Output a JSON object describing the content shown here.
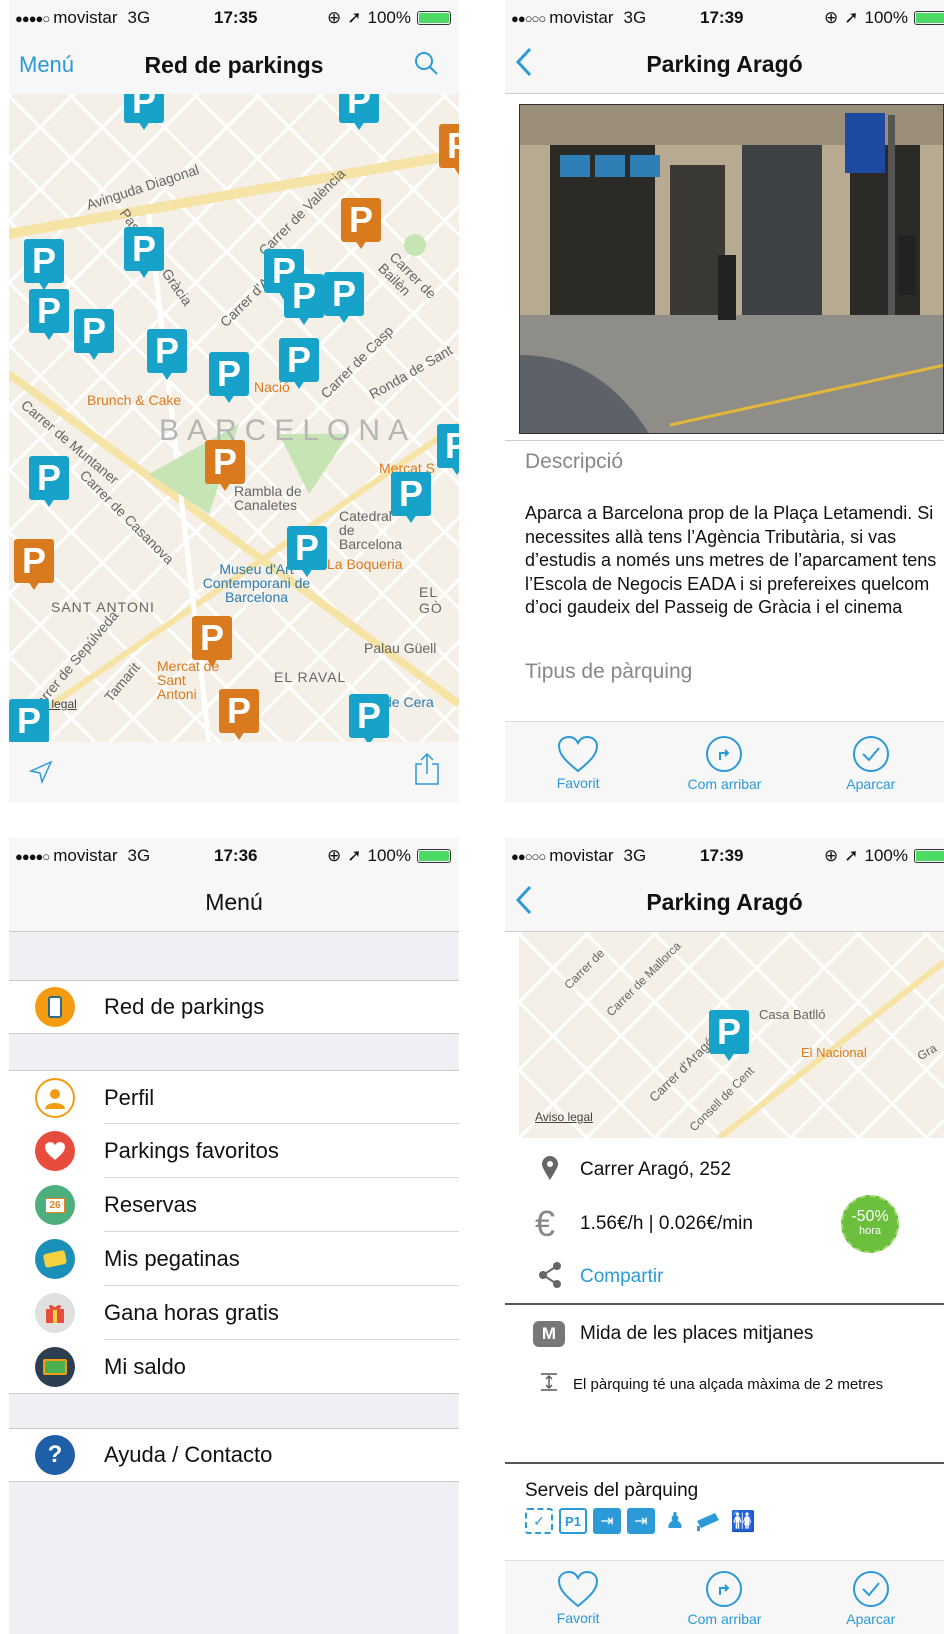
{
  "status_bar": {
    "signal": "●●●●○",
    "signal_weak": "●●○○○",
    "carrier": "movistar",
    "network": "3G",
    "battery": "100%",
    "times": {
      "s1": "17:35",
      "s2": "17:39",
      "s3": "17:36",
      "s4": "17:39"
    }
  },
  "screen_map": {
    "menu_label": "Menú",
    "title": "Red de parkings",
    "labels": {
      "avinguda_diagonal": "Avinguda Diagonal",
      "carrer_valencia": "Carrer de València",
      "carrer_arago": "Carrer d'Aragó",
      "passeig_gracia": "Passeig de Gràcia",
      "barcelona": "BARCELONA",
      "carrer_muntaner": "Carrer de Muntaner",
      "brunch_cake": "Brunch & Cake",
      "ronda_sant": "Ronda de Sant",
      "carrer_casp": "Carrer de Casp",
      "carrer_bailen": "Carrer de Bailèn",
      "rambla_canaletes": "Rambla de Canaletes",
      "catedral": "Catedral de Barcelona",
      "museu": "Museu d'Art Contemporani de Barcelona",
      "boqueria": "La Boqueria",
      "sant_antoni": "SANT ANTONI",
      "el_raval": "EL RAVAL",
      "el_gotic": "EL GÒ",
      "palau_guell": "Palau Güell",
      "mercat_sant_antoni": "Mercat de Sant Antoni",
      "mercat_santa": "Mercat S",
      "carrer_sepulveda": "Carrer de Sepúlveda",
      "carrer_casanova": "Carrer de Casanova",
      "carrer_tamarit": "Tamarit",
      "aviso_legal": "Aviso legal",
      "de_cera": "de Cera",
      "nacio": "Nació"
    }
  },
  "screen_detail": {
    "title": "Parking Aragó",
    "description_heading": "Descripció",
    "description": "Aparca a Barcelona prop de la Plaça Letamendi. Si necessites allà tens l’Agència Tributària, si vas d’estudis a només uns metres de l’aparcament tens l’Escola de Negocis EADA i si prefereixes quelcom d’oci gaudeix del Passeig de Gràcia i el cinema",
    "type_heading": "Tipus de pàrquing"
  },
  "tabs": {
    "favorit": "Favorit",
    "com_arribar": "Com arribar",
    "aparcar": "Aparcar"
  },
  "screen_menu": {
    "title": "Menú",
    "items": [
      {
        "label": "Red de parkings"
      },
      {
        "label": "Perfil"
      },
      {
        "label": "Parkings favoritos"
      },
      {
        "label": "Reservas"
      },
      {
        "label": "Mis pegatinas"
      },
      {
        "label": "Gana horas gratis"
      },
      {
        "label": "Mi saldo"
      },
      {
        "label": "Ayuda / Contacto"
      }
    ],
    "calendar_day": "26"
  },
  "screen_info": {
    "title": "Parking Aragó",
    "address": "Carrer Aragó, 252",
    "price": "1.56€/h | 0.026€/min",
    "share": "Compartir",
    "size": "Mida de les places mitjanes",
    "height": "El pàrquing té una alçada màxima de 2 metres",
    "discount": "-50%",
    "discount_unit": "hora",
    "services_heading": "Serveis del pàrquing",
    "service_p1": "P1",
    "map_labels": {
      "casa_batllo": "Casa Batlló",
      "el_nacional": "El Nacional",
      "carrer_mallorca": "Carrer de Mallorca",
      "carrer_arago": "Carrer d'Aragó",
      "consell_cent": "Consell de Cent",
      "aviso_legal": "Aviso legal",
      "carrer_de": "Carrer de",
      "gran": "Gra"
    }
  },
  "colors": {
    "accent": "#2b9ad6",
    "pin_cyan": "#16a2c9",
    "pin_orange": "#d97a1e",
    "discount_green": "#6cbf3c"
  }
}
